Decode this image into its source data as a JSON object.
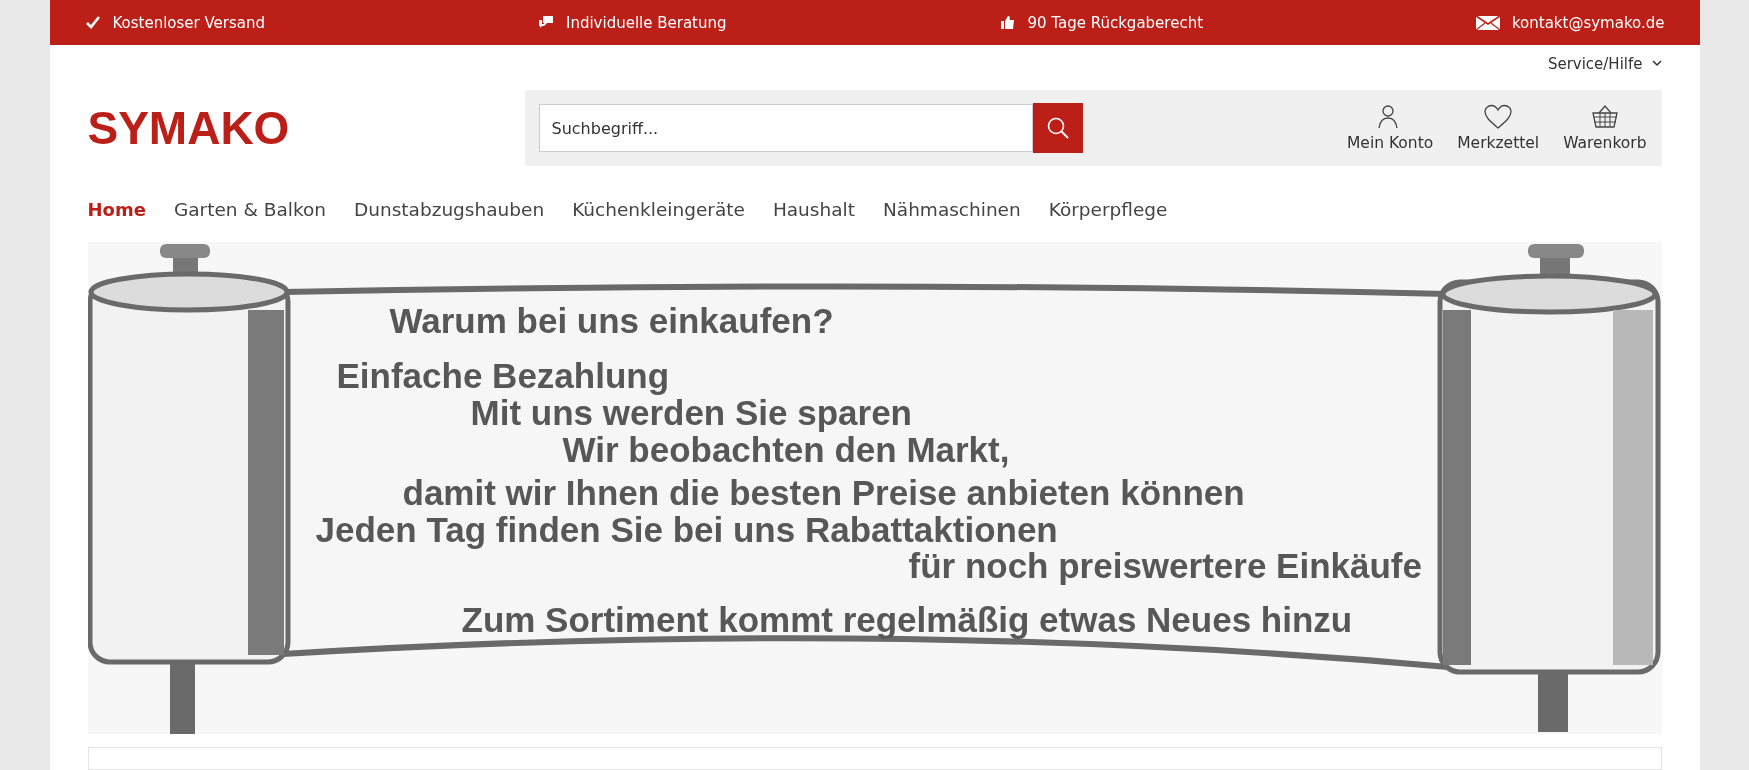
{
  "top_bar": [
    {
      "kind": "check",
      "text": "Kostenloser Versand"
    },
    {
      "kind": "chat",
      "text": "Individuelle Beratung"
    },
    {
      "kind": "thumb",
      "text": "90 Tage Rückgaberecht"
    },
    {
      "kind": "mail",
      "text": "kontakt@symako.de"
    }
  ],
  "service_menu": "Service/Hilfe",
  "logo": "SYMAKO",
  "search": {
    "placeholder": "Suchbegriff..."
  },
  "header_actions": [
    {
      "kind": "account",
      "label": "Mein Konto"
    },
    {
      "kind": "wishlist",
      "label": "Merkzettel"
    },
    {
      "kind": "cart",
      "label": "Warenkorb"
    }
  ],
  "nav": [
    {
      "label": "Home",
      "selected": true
    },
    {
      "label": "Garten & Balkon",
      "selected": false
    },
    {
      "label": "Dunstabzugshauben",
      "selected": false
    },
    {
      "label": "Küchenkleingeräte",
      "selected": false
    },
    {
      "label": "Haushalt",
      "selected": false
    },
    {
      "label": "Nähmaschinen",
      "selected": false
    },
    {
      "label": "Körperpflege",
      "selected": false
    }
  ],
  "banner": {
    "lines": [
      "Warum bei uns einkaufen?",
      "Einfache Bezahlung",
      "Mit uns werden Sie sparen",
      "Wir beobachten den Markt,",
      "damit wir Ihnen die besten Preise anbieten können",
      "Jeden Tag finden Sie bei uns Rabattaktionen",
      "für noch preiswertere Einkäufe",
      "Zum Sortiment kommt regelmäßig etwas Neues hinzu"
    ]
  }
}
